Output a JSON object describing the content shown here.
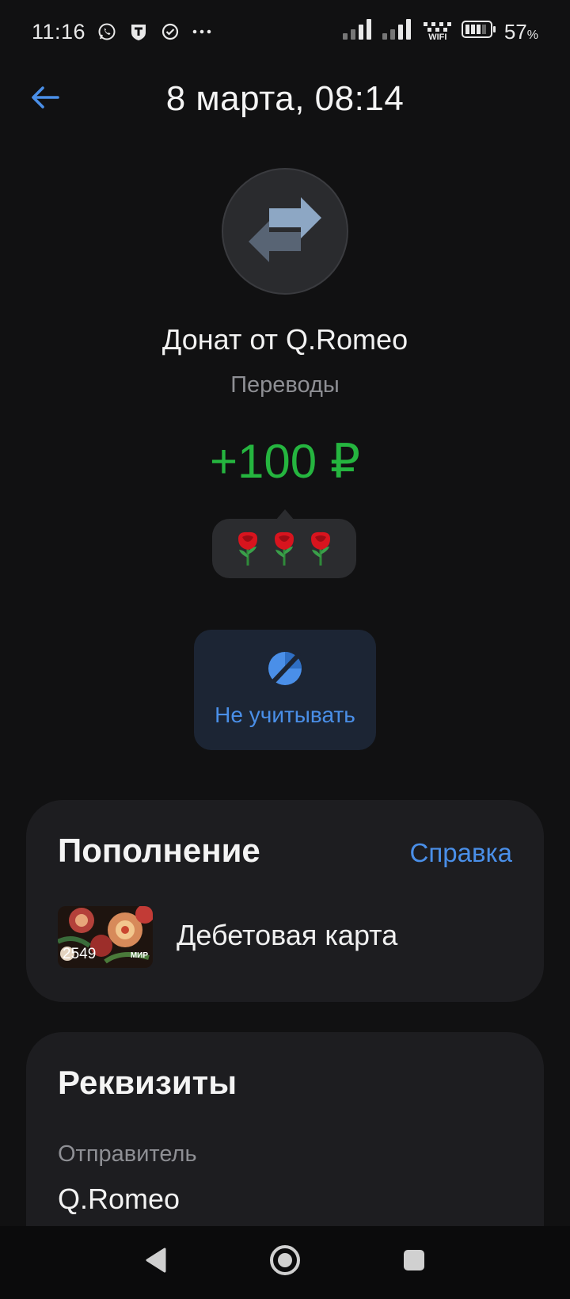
{
  "status_bar": {
    "time": "11:16",
    "notification_icons": [
      "whatsapp-icon",
      "shield-t-icon",
      "check-circle-icon",
      "more-icon"
    ],
    "battery_percent": "57",
    "battery_unit": "%",
    "wifi_label": "WIFI"
  },
  "header": {
    "title": "8 марта, 08:14",
    "back_icon": "arrow-left-icon"
  },
  "transaction": {
    "icon": "transfer-arrows-icon",
    "title": "Донат от Q.Romeo",
    "category": "Переводы",
    "amount": "+100 ₽",
    "message_emojis": [
      "rose",
      "rose",
      "rose"
    ]
  },
  "actions": {
    "exclude_label": "Не учитывать",
    "exclude_icon": "pie-strikethrough-icon"
  },
  "topup_card": {
    "heading": "Пополнение",
    "help_link": "Справка",
    "bank_card": {
      "last_digits": "2549",
      "brand": "МИР",
      "name": "Дебетовая карта"
    }
  },
  "details_card": {
    "heading": "Реквизиты",
    "sender_label": "Отправитель",
    "sender_value": "Q.Romeo"
  },
  "nav_bar": {
    "buttons": [
      "back-triangle-icon",
      "home-circle-icon",
      "recents-square-icon"
    ]
  },
  "colors": {
    "background": "#111112",
    "card": "#1d1d20",
    "accent_blue": "#4a8fe8",
    "amount_green": "#25b53f",
    "muted_text": "#8e8f94"
  }
}
